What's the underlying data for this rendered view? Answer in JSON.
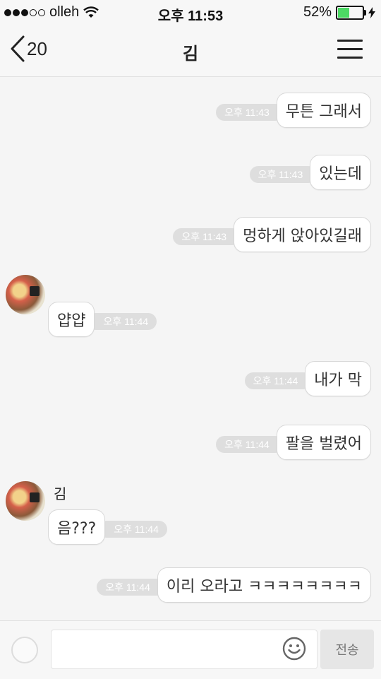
{
  "status_bar": {
    "carrier": "olleh",
    "time": "오후 11:53",
    "battery": "52%",
    "battery_level": 0.52,
    "battery_color": "#4cd964"
  },
  "header": {
    "back_count": "20",
    "title": "김"
  },
  "messages": [
    {
      "side": "out",
      "text": "무튼 그래서",
      "time": "오후 11:43"
    },
    {
      "side": "out",
      "text": "있는데",
      "time": "오후 11:43"
    },
    {
      "side": "out",
      "text": "멍하게 앉아있길래",
      "time": "오후 11:43"
    },
    {
      "side": "in",
      "text": "얍얍",
      "time": "오후 11:44"
    },
    {
      "side": "out",
      "text": "내가 막",
      "time": "오후 11:44"
    },
    {
      "side": "out",
      "text": "팔을 벌렸어",
      "time": "오후 11:44"
    },
    {
      "side": "in",
      "sender": "김",
      "text": "음???",
      "time": "오후 11:44"
    },
    {
      "side": "out",
      "text": "이리 오라고 ㅋㅋㅋㅋㅋㅋㅋㅋ",
      "time": "오후 11:44"
    }
  ],
  "input": {
    "send_label": "전송"
  },
  "colors": {
    "background": "#f5f5f5",
    "bubble": "#ffffff",
    "time_pill": "#dedede"
  },
  "icons": [
    "wifi-icon",
    "charging-bolt-icon",
    "back-chevron-icon",
    "menu-icon",
    "attach-icon",
    "emoji-icon"
  ]
}
